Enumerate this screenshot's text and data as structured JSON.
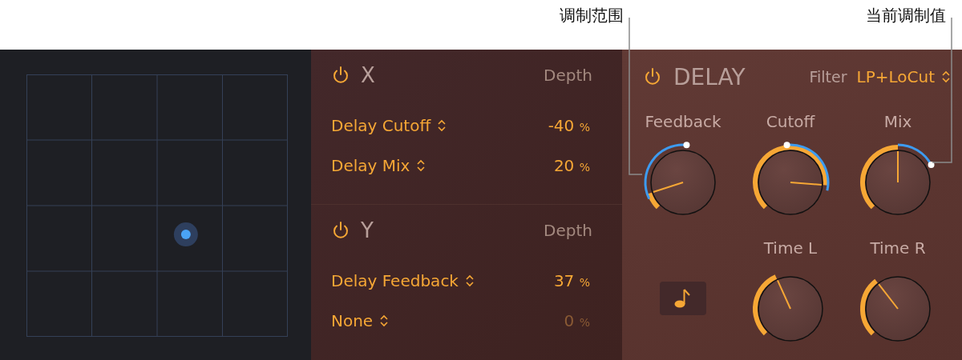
{
  "callouts": [
    {
      "text": "调制范围"
    },
    {
      "text": "当前调制值"
    }
  ],
  "axes": [
    {
      "name": "X",
      "on": true,
      "depth_label": "Depth",
      "rows": [
        {
          "target": "Delay Cutoff",
          "value": "-40",
          "unit": "%",
          "disabled": false
        },
        {
          "target": "Delay Mix",
          "value": "20",
          "unit": "%",
          "disabled": false
        }
      ]
    },
    {
      "name": "Y",
      "on": true,
      "depth_label": "Depth",
      "rows": [
        {
          "target": "Delay Feedback",
          "value": "37",
          "unit": "%",
          "disabled": false
        },
        {
          "target": "None",
          "value": "0",
          "unit": "%",
          "disabled": true
        }
      ]
    }
  ],
  "delay": {
    "title": "DELAY",
    "on": true,
    "filter": {
      "label": "Filter",
      "value": "LP+LoCut"
    },
    "knobs": [
      {
        "kind": "knob",
        "label": "Feedback",
        "modulated": true
      },
      {
        "kind": "knob",
        "label": "Cutoff",
        "modulated": true
      },
      {
        "kind": "knob",
        "label": "Mix",
        "modulated": true
      },
      {
        "kind": "sync",
        "selected": false
      },
      {
        "kind": "knob",
        "label": "Time L",
        "modulated": false
      },
      {
        "kind": "knob",
        "label": "Time R",
        "modulated": false
      }
    ]
  }
}
